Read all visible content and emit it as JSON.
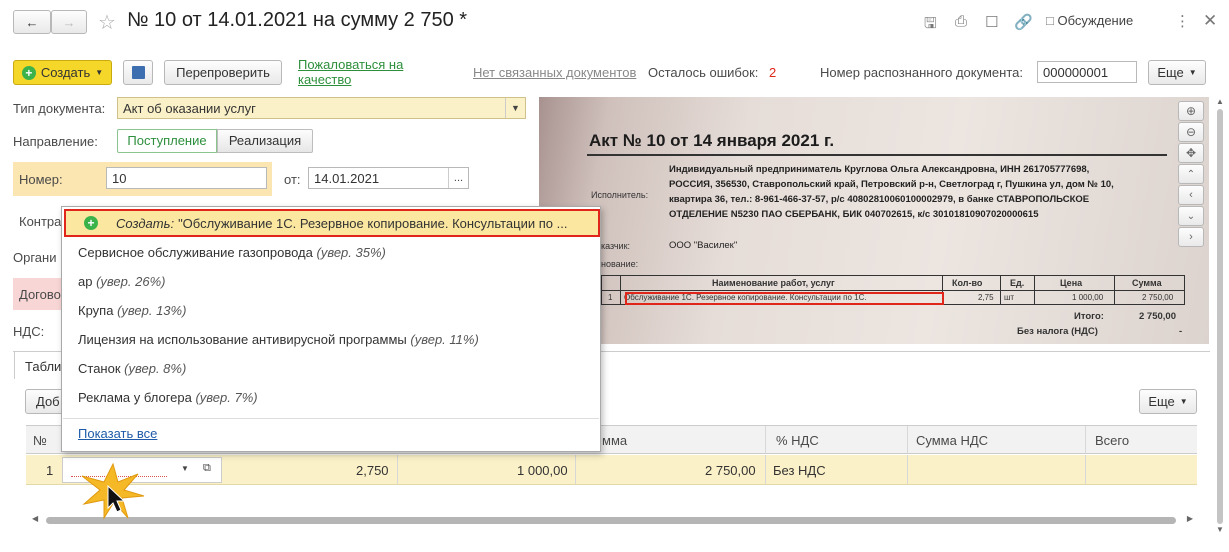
{
  "window": {
    "title": "№ 10 от 14.01.2021 на сумму 2 750 *",
    "discussion": "Обсуждение"
  },
  "toolbar": {
    "create": "Создать",
    "recheck": "Перепроверить",
    "complain": "Пожаловаться на качество",
    "no_linked": "Нет связанных документов",
    "errors_label": "Осталось ошибок:",
    "errors_count": "2",
    "recognized_label": "Номер распознанного документа:",
    "recognized_value": "000000001",
    "more": "Еще"
  },
  "form": {
    "doc_type_label": "Тип документа:",
    "doc_type_value": "Акт об оказании услуг",
    "direction_label": "Направление:",
    "direction_in": "Поступление",
    "direction_out": "Реализация",
    "number_label": "Номер:",
    "number_value": "10",
    "date_label": "от:",
    "date_value": "14.01.2021",
    "counterparty_label": "Контра",
    "org_label": "Органи",
    "contract_label": "Догово",
    "vat_label": "НДС:",
    "tab_label": "Табли",
    "add_button": "Доб",
    "table_more": "Еще"
  },
  "popup": {
    "create_prefix": "Создать:",
    "create_text": "\"Обслуживание 1С. Резервное копирование. Консультации по ...",
    "items": [
      {
        "name": "Сервисное обслуживание газопровода",
        "hint": "(увер. 35%)"
      },
      {
        "name": "ар",
        "hint": "(увер. 26%)"
      },
      {
        "name": "Крупа",
        "hint": "(увер. 13%)"
      },
      {
        "name": "Лицензия на использование антивирусной программы",
        "hint": "(увер. 11%)"
      },
      {
        "name": "Станок",
        "hint": "(увер. 8%)"
      },
      {
        "name": "Реклама у блогера",
        "hint": "(увер. 7%)"
      }
    ],
    "show_all": "Показать все"
  },
  "table": {
    "headers": {
      "num": "№",
      "sum_partial": "мма",
      "vat_pct": "% НДС",
      "vat_sum": "Сумма НДС",
      "total": "Всего"
    },
    "row": {
      "num": "1",
      "qty": "2,750",
      "price": "1 000,00",
      "sum": "2 750,00",
      "vat": "Без НДС"
    }
  },
  "scan": {
    "heading": "Акт № 10 от 14 января 2021 г.",
    "executor_label": "Исполнитель:",
    "executor_l1": "Индивидуальный предприниматель Круглова Ольга Александровна, ИНН 261705777698,",
    "executor_l2": "РОССИЯ, 356530, Ставропольский край, Петровский р-н, Светлоград г, Пушкина ул, дом № 10,",
    "executor_l3": "квартира 36, тел.: 8-961-466-37-57, р/с 40802810060100002979, в банке СТАВРОПОЛЬСКОЕ",
    "executor_l4": "ОТДЕЛЕНИЕ N5230 ПАО СБЕРБАНК, БИК 040702615, к/с 30101810907020000615",
    "customer_label": "казчик:",
    "customer_value": "ООО \"Василек\"",
    "basis_label": "нование:",
    "col_name": "Наименование работ, услуг",
    "col_qty": "Кол-во",
    "col_unit": "Ед.",
    "col_price": "Цена",
    "col_sum": "Сумма",
    "row_num": "1",
    "row_name": "Обслуживание 1С. Резервное копирование. Консультации по 1С.",
    "row_qty": "2,75",
    "row_unit": "шт",
    "row_price": "1 000,00",
    "row_sum": "2 750,00",
    "total_label": "Итого:",
    "total_value": "2 750,00",
    "vat_label": "Без налога (НДС)",
    "vat_value": "-"
  },
  "colors": {
    "accent_yellow": "#f5d72a",
    "green": "#2d8f3c",
    "error_red": "#e0261b"
  }
}
